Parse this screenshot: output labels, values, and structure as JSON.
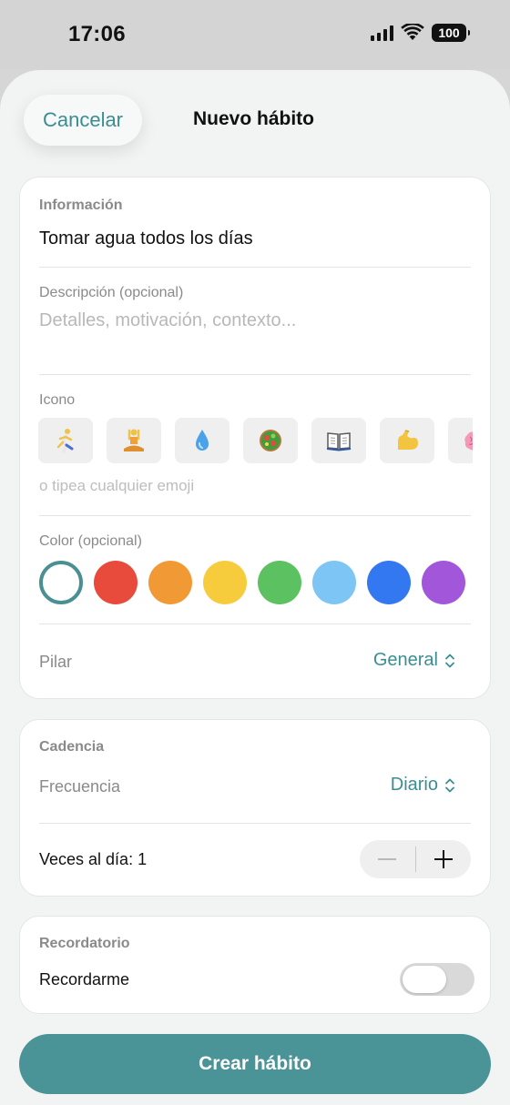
{
  "status": {
    "time": "17:06",
    "battery": "100"
  },
  "header": {
    "cancel": "Cancelar",
    "title": "Nuevo hábito"
  },
  "info": {
    "section": "Información",
    "name_value": "Tomar agua todos los días",
    "description_label": "Descripción (opcional)",
    "description_placeholder": "Detalles, motivación, contexto...",
    "icon_label": "Icono",
    "icons": [
      "runner-emoji-icon",
      "meditation-emoji-icon",
      "droplet-emoji-icon",
      "salad-emoji-icon",
      "book-emoji-icon",
      "flexed-biceps-emoji-icon",
      "brain-emoji-icon"
    ],
    "icon_hint": "o tipea cualquier emoji",
    "color_label": "Color (opcional)",
    "colors": [
      "#ffffff",
      "#e84a3c",
      "#f19a35",
      "#f7cc3c",
      "#5cc160",
      "#7cc5f4",
      "#3478f1",
      "#a256d9"
    ],
    "selected_color_index": 0,
    "pillar_label": "Pilar",
    "pillar_value": "General"
  },
  "cadence": {
    "section": "Cadencia",
    "frequency_label": "Frecuencia",
    "frequency_value": "Diario",
    "times_label": "Veces al día: 1"
  },
  "reminder": {
    "section": "Recordatorio",
    "toggle_label": "Recordarme",
    "enabled": false
  },
  "footer": {
    "create": "Crear hábito"
  },
  "theme": {
    "accent": "#3a8e91",
    "button": "#4a9396"
  }
}
